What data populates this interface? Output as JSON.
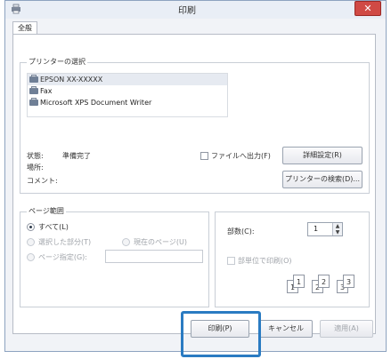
{
  "window": {
    "title": "印刷",
    "close_glyph": "✕",
    "accent_color": "#2a7bc2"
  },
  "tabs": [
    {
      "label": "全般"
    }
  ],
  "printer_select": {
    "group_title": "プリンターの選択",
    "printers": [
      {
        "name": "EPSON XX-XXXXX",
        "selected": true
      },
      {
        "name": "Fax",
        "selected": false
      },
      {
        "name": "Microsoft XPS Document Writer",
        "selected": false
      }
    ],
    "status_label": "状態:",
    "status_value": "準備完了",
    "location_label": "場所:",
    "comment_label": "コメント:",
    "print_to_file_label": "ファイルへ出力(F)",
    "preferences_button": "詳細設定(R)",
    "find_printer_button": "プリンターの検索(D)..."
  },
  "page_range": {
    "group_title": "ページ範囲",
    "all_label": "すべて(L)",
    "selection_label": "選択した部分(T)",
    "current_page_label": "現在のページ(U)",
    "pages_label": "ページ指定(G):",
    "pages_value": ""
  },
  "copies": {
    "copies_label": "部数(C):",
    "copies_value": "1",
    "collate_label": "部単位で印刷(O)",
    "collate_pages": [
      "1",
      "1",
      "2",
      "2",
      "3",
      "3"
    ]
  },
  "footer": {
    "print_button": "印刷(P)",
    "cancel_button": "キャンセル",
    "apply_button": "適用(A)"
  }
}
